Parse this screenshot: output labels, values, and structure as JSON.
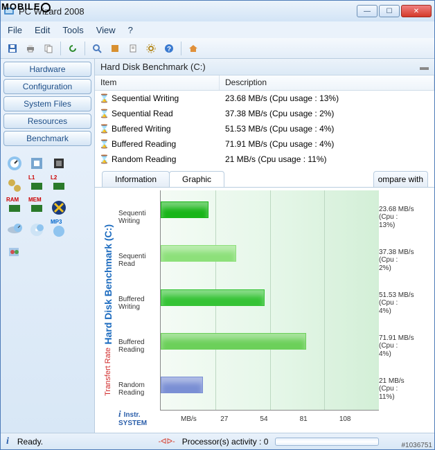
{
  "watermark": "MOBILE",
  "window": {
    "title": "PC Wizard 2008"
  },
  "menu": {
    "file": "File",
    "edit": "Edit",
    "tools": "Tools",
    "view": "View",
    "help": "?"
  },
  "sidebar": {
    "hardware": "Hardware",
    "configuration": "Configuration",
    "systemfiles": "System Files",
    "resources": "Resources",
    "benchmark": "Benchmark"
  },
  "panel": {
    "title": "Hard Disk Benchmark (C:)"
  },
  "columns": {
    "item": "Item",
    "description": "Description"
  },
  "rows": [
    {
      "name": "Sequential Writing",
      "desc": "23.68 MB/s  (Cpu usage : 13%)"
    },
    {
      "name": "Sequential Read",
      "desc": "37.38 MB/s  (Cpu usage : 2%)"
    },
    {
      "name": "Buffered Writing",
      "desc": "51.53 MB/s  (Cpu usage : 4%)"
    },
    {
      "name": "Buffered Reading",
      "desc": "71.91 MB/s  (Cpu usage : 4%)"
    },
    {
      "name": "Random Reading",
      "desc": "21 MB/s  (Cpu usage : 11%)"
    }
  ],
  "tabs": {
    "information": "Information",
    "graphic": "Graphic",
    "compare": "ompare with"
  },
  "chart": {
    "ytitle": "Hard Disk Benchmark (C:)",
    "ysub": "Transfert Rate",
    "cats": [
      {
        "label": "Sequenti\nWriting",
        "val": "23.68",
        "cpu": "13%",
        "color": "#19b519",
        "pct": 21.9
      },
      {
        "label": "Sequenti\nRead",
        "val": "37.38",
        "cpu": "2%",
        "color": "#8de07a",
        "pct": 34.6
      },
      {
        "label": "Buffered\nWriting",
        "val": "51.53",
        "cpu": "4%",
        "color": "#35c335",
        "pct": 47.7
      },
      {
        "label": "Buffered\nReading",
        "val": "71.91",
        "cpu": "4%",
        "color": "#6cd05a",
        "pct": 66.6
      },
      {
        "label": "Random\nReading",
        "val": "21",
        "cpu": "11%",
        "color": "#7a8fd4",
        "pct": 19.4
      }
    ],
    "ticks": [
      "MB/s",
      "27",
      "54",
      "81",
      "108"
    ],
    "instr": "Instr.\nSYSTEM"
  },
  "status": {
    "ready": "Ready.",
    "proc": "Processor(s) activity : 0"
  },
  "imgid": "#1036751",
  "chart_data": {
    "type": "bar",
    "title": "Hard Disk Benchmark (C:) — Transfert Rate",
    "xlabel": "MB/s",
    "ylabel": "",
    "xlim": [
      0,
      108
    ],
    "categories": [
      "Sequential Writing",
      "Sequential Read",
      "Buffered Writing",
      "Buffered Reading",
      "Random Reading"
    ],
    "series": [
      {
        "name": "Transfer Rate (MB/s)",
        "values": [
          23.68,
          37.38,
          51.53,
          71.91,
          21
        ]
      },
      {
        "name": "CPU Usage (%)",
        "values": [
          13,
          2,
          4,
          4,
          11
        ]
      }
    ],
    "ticks": [
      0,
      27,
      54,
      81,
      108
    ]
  }
}
